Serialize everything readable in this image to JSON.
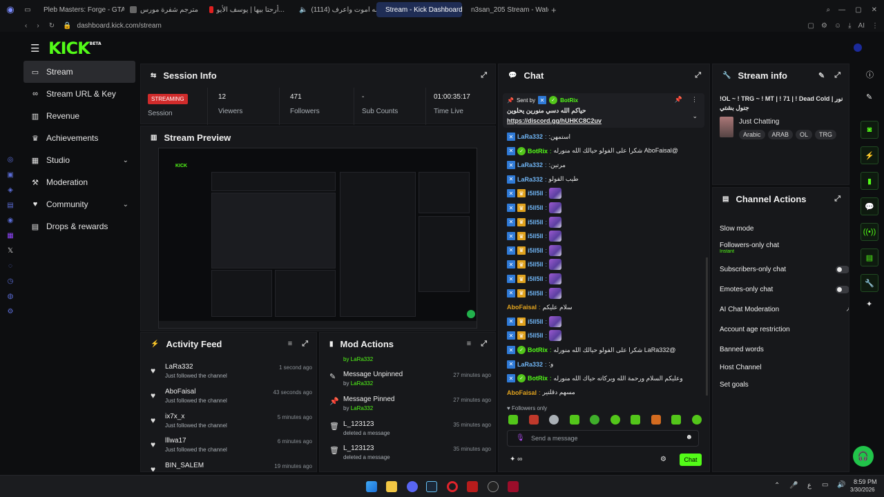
{
  "browser": {
    "tabs": [
      {
        "label": "Pleb Masters: Forge - GTA",
        "color": "#3a7bd5"
      },
      {
        "label": "مترجم شفرة مورس",
        "color": "#888888"
      },
      {
        "label": "أرحتا بيها | يوسف الأيو...",
        "color": "#e02020"
      },
      {
        "label": "(1114) شيله اموت واعرف...",
        "color": "#e02020"
      },
      {
        "label": "Stream - Kick Dashboard",
        "color": "#53fc18"
      },
      {
        "label": "n3san_205 Stream - Watc",
        "color": "#53fc18"
      }
    ],
    "url": "dashboard.kick.com/stream"
  },
  "app": {
    "logo": "KICK",
    "logo_sup": "BETA"
  },
  "sidebar": {
    "items": [
      {
        "label": "Stream",
        "icon": "stream-icon"
      },
      {
        "label": "Stream URL & Key",
        "icon": "link-icon"
      },
      {
        "label": "Revenue",
        "icon": "bar-chart-icon"
      },
      {
        "label": "Achievements",
        "icon": "trophy-icon"
      },
      {
        "label": "Studio",
        "icon": "studio-icon"
      },
      {
        "label": "Moderation",
        "icon": "hammer-icon"
      },
      {
        "label": "Community",
        "icon": "community-icon"
      },
      {
        "label": "Drops & rewards",
        "icon": "gift-icon"
      }
    ]
  },
  "session": {
    "title": "Session Info",
    "status": "STREAMING",
    "status_label": "Session",
    "viewers": "12",
    "viewers_label": "Viewers",
    "followers": "471",
    "followers_label": "Followers",
    "subs": "-",
    "subs_label": "Sub Counts",
    "time": "01:00:35:17",
    "time_label": "Time Live"
  },
  "preview": {
    "title": "Stream Preview"
  },
  "activity": {
    "title": "Activity Feed",
    "items": [
      {
        "name": "LaRa332",
        "desc": "Just followed the channel",
        "time": "1 second ago"
      },
      {
        "name": "AboFaisal",
        "desc": "Just followed the channel",
        "time": "43 seconds ago"
      },
      {
        "name": "ix7x_x",
        "desc": "Just followed the channel",
        "time": "5 minutes ago"
      },
      {
        "name": "lllwa17",
        "desc": "Just followed the channel",
        "time": "6 minutes ago"
      },
      {
        "name": "BIN_SALEM",
        "desc": "",
        "time": "19 minutes ago"
      }
    ]
  },
  "mod": {
    "title": "Mod Actions",
    "top_by": "by LaRa332",
    "items": [
      {
        "name": "Message Unpinned",
        "by": "by",
        "user": "LaRa332",
        "time": "27 minutes ago"
      },
      {
        "name": "Message Pinned",
        "by": "by",
        "user": "LaRa332",
        "time": "27 minutes ago"
      },
      {
        "name": "L_123123",
        "desc": "deleted a message",
        "time": "35 minutes ago"
      },
      {
        "name": "L_123123",
        "desc": "deleted a message",
        "time": "35 minutes ago"
      }
    ]
  },
  "chat": {
    "title": "Chat",
    "pinned_sent_by": "Sent by",
    "pinned_user": "BotRix",
    "pinned_text": "حياكم الله دسي منورين يحلوين",
    "pinned_link": "https://discord.gg/hUHKC8C2uv",
    "messages": [
      {
        "user": "LaRa332",
        "color": "#6fb3f2",
        "text": "استمهن:",
        "badges": "k"
      },
      {
        "user": "BotRix",
        "color": "#53fc18",
        "text": "@AboFaisal شكرا على الفولو حيالك الله منورله",
        "badges": "kv"
      },
      {
        "user": "LaRa332",
        "color": "#6fb3f2",
        "text": "مرتين:",
        "badges": "k"
      },
      {
        "user": "LaRa332",
        "color": "#6fb3f2",
        "text": "طيب الفولو",
        "badges": "k"
      },
      {
        "user": "i5ll5ll",
        "color": "#6fb3f2",
        "text": "",
        "badges": "kc",
        "emote": true
      },
      {
        "user": "i5ll5ll",
        "color": "#6fb3f2",
        "text": "",
        "badges": "kc",
        "emote": true
      },
      {
        "user": "i5ll5ll",
        "color": "#6fb3f2",
        "text": "",
        "badges": "kc",
        "emote": true
      },
      {
        "user": "i5ll5ll",
        "color": "#6fb3f2",
        "text": "",
        "badges": "kc",
        "emote": true
      },
      {
        "user": "i5ll5ll",
        "color": "#6fb3f2",
        "text": "",
        "badges": "kc",
        "emote": true
      },
      {
        "user": "i5ll5ll",
        "color": "#6fb3f2",
        "text": "",
        "badges": "kc",
        "emote": true
      },
      {
        "user": "i5ll5ll",
        "color": "#6fb3f2",
        "text": "",
        "badges": "kc",
        "emote": true
      },
      {
        "user": "i5ll5ll",
        "color": "#6fb3f2",
        "text": "",
        "badges": "kc",
        "emote": true
      },
      {
        "user": "AboFaisal",
        "color": "#e0a21e",
        "text": "سلام عليكم",
        "badges": ""
      },
      {
        "user": "i5ll5ll",
        "color": "#6fb3f2",
        "text": "",
        "badges": "kc",
        "emote": true
      },
      {
        "user": "i5ll5ll",
        "color": "#6fb3f2",
        "text": "",
        "badges": "kc",
        "emote": true
      },
      {
        "user": "BotRix",
        "color": "#53fc18",
        "text": "@LaRa332 شكرا على الفولو حيالك الله منورله",
        "badges": "kv"
      },
      {
        "user": "LaRa332",
        "color": "#6fb3f2",
        "text": "و:",
        "badges": "k"
      },
      {
        "user": "BotRix",
        "color": "#53fc18",
        "text": "وعليكم السلام ورحمة الله وبركاته حياك الله منورله",
        "badges": "kv"
      },
      {
        "user": "AboFaisal",
        "color": "#e0a21e",
        "text": "مسهم دقلتير",
        "badges": ""
      }
    ],
    "followers_only": "Followers only",
    "input_placeholder": "Send a message",
    "send_label": "Chat"
  },
  "streaminfo": {
    "title": "Stream info",
    "stream_title": "!OL ~ ! TRG ~ ! MT | ! 71 | ! Dead Cold | نور جنول بشتي",
    "category": "Just Chatting",
    "tags": [
      "Arabic",
      "ARAB",
      "OL",
      "TRG"
    ]
  },
  "actions": {
    "title": "Channel Actions",
    "items": [
      {
        "label": "Slow mode",
        "kind": "chevron"
      },
      {
        "label": "Followers-only chat",
        "sub": "Instant",
        "kind": "chevron"
      },
      {
        "label": "Subscribers-only chat",
        "kind": "toggle"
      },
      {
        "label": "Emotes-only chat",
        "kind": "toggle"
      },
      {
        "label": "AI Chat Moderation",
        "kind": "external"
      },
      {
        "label": "Account age restriction",
        "kind": "chevron"
      },
      {
        "label": "Banned words",
        "kind": "chevron"
      },
      {
        "label": "Host Channel",
        "kind": "none"
      },
      {
        "label": "Set goals",
        "kind": "chevron"
      }
    ]
  },
  "taskbar": {
    "time": "8:59 PM",
    "date": "3/30/2026",
    "lang": "ع"
  },
  "colors": {
    "accent": "#53fc18",
    "panel": "#17181b",
    "bg": "#0d0e10"
  }
}
